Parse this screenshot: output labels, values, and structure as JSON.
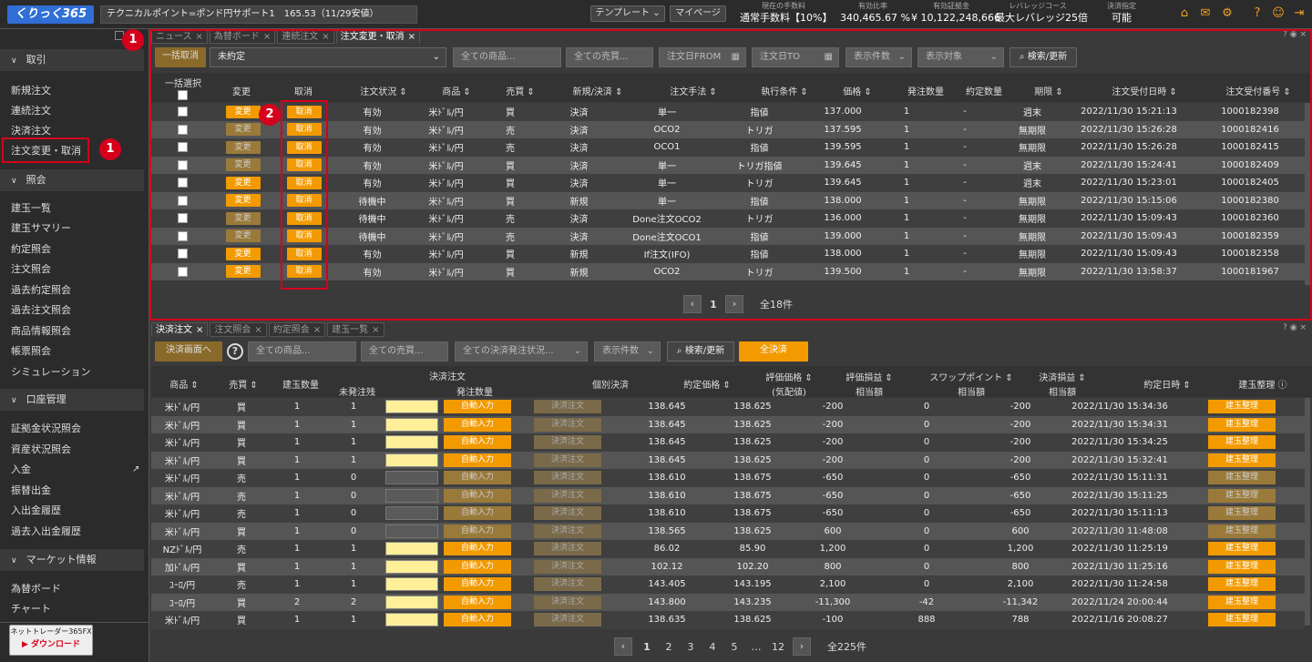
{
  "topbar": {
    "logo": "くりっく365",
    "ticker": "テクニカルポイント=ポンド円サポート1　165.53（11/29安値）",
    "template_btn": "テンプレート ⌄",
    "mypage_btn": "マイページ",
    "stats": [
      {
        "label": "現在の手数料",
        "value": "通常手数料【10%】"
      },
      {
        "label": "有効比率",
        "value": "340,465.67 %"
      },
      {
        "label": "有効証拠金",
        "value": "¥ 10,122,248,666"
      },
      {
        "label": "レバレッジコース",
        "value": "最大レバレッジ25倍"
      },
      {
        "label": "決済指定",
        "value": "可能"
      }
    ]
  },
  "sidebar": {
    "sections": [
      {
        "label": "取引",
        "items": [
          "新規注文",
          "連続注文",
          "決済注文",
          "注文変更・取消"
        ]
      },
      {
        "label": "照会",
        "items": [
          "建玉一覧",
          "建玉サマリー",
          "約定照会",
          "注文照会",
          "過去約定照会",
          "過去注文照会",
          "商品情報照会",
          "帳票照会",
          "シミュレーション"
        ]
      },
      {
        "label": "口座管理",
        "items": [
          "証拠金状況照会",
          "資産状況照会",
          "入金",
          "振替出金",
          "入出金履歴",
          "過去入出金履歴"
        ]
      },
      {
        "label": "マーケット情報",
        "items": [
          "為替ボード",
          "チャート"
        ]
      }
    ],
    "download": {
      "line1": "ネットトレーダー365FX",
      "line2": "ダウンロード"
    }
  },
  "badges": {
    "one": "1",
    "two": "2"
  },
  "upper": {
    "tabs": [
      "ニュース",
      "為替ボード",
      "連続注文",
      "注文変更・取消"
    ],
    "bulk_cancel": "一括取消",
    "status_select": "未約定",
    "filters": [
      "全ての商品...",
      "全ての売買...",
      "注文日FROM",
      "注文日TO",
      "表示件数",
      "表示対象"
    ],
    "search": "検索/更新",
    "headers": [
      "一括選択",
      "変更",
      "取消",
      "注文状況",
      "商品",
      "売買",
      "新規/決済",
      "注文手法",
      "執行条件",
      "価格",
      "発注数量",
      "約定数量",
      "期限",
      "注文受付日時",
      "注文受付番号"
    ],
    "change_label": "変更",
    "cancel_label": "取消",
    "rows": [
      {
        "change_active": true,
        "status": "有効",
        "product": "米ﾄﾞﾙ/円",
        "side": "買",
        "type": "決済",
        "method": "単一",
        "cond": "指値",
        "cond_link": false,
        "price": "137.000",
        "qty": "1",
        "filled": "-",
        "expiry": "週末",
        "date": "2022/11/30 15:21:13",
        "no": "1000182398"
      },
      {
        "change_active": false,
        "status": "有効",
        "product": "米ﾄﾞﾙ/円",
        "side": "売",
        "type": "決済",
        "method": "OCO2",
        "cond": "トリガ",
        "cond_link": false,
        "price": "137.595",
        "qty": "1",
        "filled": "-",
        "expiry": "無期限",
        "date": "2022/11/30 15:26:28",
        "no": "1000182416"
      },
      {
        "change_active": false,
        "status": "有効",
        "product": "米ﾄﾞﾙ/円",
        "side": "売",
        "type": "決済",
        "method": "OCO1",
        "cond": "指値",
        "cond_link": false,
        "price": "139.595",
        "qty": "1",
        "filled": "-",
        "expiry": "無期限",
        "date": "2022/11/30 15:26:28",
        "no": "1000182415"
      },
      {
        "change_active": false,
        "status": "有効",
        "product": "米ﾄﾞﾙ/円",
        "side": "買",
        "type": "決済",
        "method": "単一",
        "cond": "トリガ指値",
        "cond_link": true,
        "price": "139.645",
        "qty": "1",
        "filled": "-",
        "expiry": "週末",
        "date": "2022/11/30 15:24:41",
        "no": "1000182409"
      },
      {
        "change_active": true,
        "status": "有効",
        "product": "米ﾄﾞﾙ/円",
        "side": "買",
        "type": "決済",
        "method": "単一",
        "cond": "トリガ",
        "cond_link": false,
        "price": "139.645",
        "qty": "1",
        "filled": "-",
        "expiry": "週末",
        "date": "2022/11/30 15:23:01",
        "no": "1000182405"
      },
      {
        "change_active": true,
        "status": "待機中",
        "product": "米ﾄﾞﾙ/円",
        "side": "買",
        "type": "新規",
        "method": "単一",
        "cond": "指値",
        "cond_link": false,
        "price": "138.000",
        "qty": "1",
        "filled": "-",
        "expiry": "無期限",
        "date": "2022/11/30 15:15:06",
        "no": "1000182380"
      },
      {
        "change_active": false,
        "status": "待機中",
        "product": "米ﾄﾞﾙ/円",
        "side": "売",
        "type": "決済",
        "method": "Done注文OCO2",
        "cond": "トリガ",
        "cond_link": false,
        "price": "136.000",
        "qty": "1",
        "filled": "-",
        "expiry": "無期限",
        "date": "2022/11/30 15:09:43",
        "no": "1000182360"
      },
      {
        "change_active": false,
        "status": "待機中",
        "product": "米ﾄﾞﾙ/円",
        "side": "売",
        "type": "決済",
        "method": "Done注文OCO1",
        "cond": "指値",
        "cond_link": false,
        "price": "139.000",
        "qty": "1",
        "filled": "-",
        "expiry": "無期限",
        "date": "2022/11/30 15:09:43",
        "no": "1000182359"
      },
      {
        "change_active": true,
        "status": "有効",
        "product": "米ﾄﾞﾙ/円",
        "side": "買",
        "type": "新規",
        "method": "If注文(IFO)",
        "cond": "指値",
        "cond_link": false,
        "price": "138.000",
        "qty": "1",
        "filled": "-",
        "expiry": "無期限",
        "date": "2022/11/30 15:09:43",
        "no": "1000182358"
      },
      {
        "change_active": true,
        "status": "有効",
        "product": "米ﾄﾞﾙ/円",
        "side": "買",
        "type": "新規",
        "method": "OCO2",
        "cond": "トリガ",
        "cond_link": false,
        "price": "139.500",
        "qty": "1",
        "filled": "-",
        "expiry": "無期限",
        "date": "2022/11/30 13:58:37",
        "no": "1000181967"
      }
    ],
    "page": "1",
    "total": "全18件"
  },
  "lower": {
    "tabs": [
      "決済注文",
      "注文照会",
      "約定照会",
      "建玉一覧"
    ],
    "to_order_btn": "決済画面へ",
    "help": "?",
    "filters": [
      "全ての商品...",
      "全ての売買...",
      "全ての決済発注状況...",
      "表示件数"
    ],
    "search": "検索/更新",
    "all_settle": "全決済",
    "headers": {
      "product": "商品",
      "side": "売買",
      "qty": "建玉数量",
      "unfilled": "未発注残",
      "order_top": "決済注文",
      "order_qty": "発注数量",
      "individual": "個別決済",
      "price": "約定価格",
      "eval": "評価価格",
      "eval2": "(気配値)",
      "pl": "評価損益",
      "pl2": "相当額",
      "swap": "スワップポイント",
      "swap2": "相当額",
      "realized": "決済損益",
      "realized2": "相当額",
      "date": "約定日時",
      "arrange": "建玉整理"
    },
    "auto_label": "自動入力",
    "kessai_label": "決済注文",
    "arrange_label": "建玉整理",
    "rows": [
      {
        "product": "米ﾄﾞﾙ/円",
        "side": "買",
        "qty": "1",
        "unfilled": "1",
        "active": true,
        "price": "138.645",
        "eval": "138.625",
        "pl": "-200",
        "swap": "0",
        "realized": "-200",
        "date": "2022/11/30 15:34:36"
      },
      {
        "product": "米ﾄﾞﾙ/円",
        "side": "買",
        "qty": "1",
        "unfilled": "1",
        "active": true,
        "price": "138.645",
        "eval": "138.625",
        "pl": "-200",
        "swap": "0",
        "realized": "-200",
        "date": "2022/11/30 15:34:31"
      },
      {
        "product": "米ﾄﾞﾙ/円",
        "side": "買",
        "qty": "1",
        "unfilled": "1",
        "active": true,
        "price": "138.645",
        "eval": "138.625",
        "pl": "-200",
        "swap": "0",
        "realized": "-200",
        "date": "2022/11/30 15:34:25"
      },
      {
        "product": "米ﾄﾞﾙ/円",
        "side": "買",
        "qty": "1",
        "unfilled": "1",
        "active": true,
        "price": "138.645",
        "eval": "138.625",
        "pl": "-200",
        "swap": "0",
        "realized": "-200",
        "date": "2022/11/30 15:32:41"
      },
      {
        "product": "米ﾄﾞﾙ/円",
        "side": "売",
        "qty": "1",
        "unfilled": "0",
        "active": false,
        "price": "138.610",
        "eval": "138.675",
        "pl": "-650",
        "swap": "0",
        "realized": "-650",
        "date": "2022/11/30 15:11:31"
      },
      {
        "product": "米ﾄﾞﾙ/円",
        "side": "売",
        "qty": "1",
        "unfilled": "0",
        "active": false,
        "price": "138.610",
        "eval": "138.675",
        "pl": "-650",
        "swap": "0",
        "realized": "-650",
        "date": "2022/11/30 15:11:25"
      },
      {
        "product": "米ﾄﾞﾙ/円",
        "side": "売",
        "qty": "1",
        "unfilled": "0",
        "active": false,
        "price": "138.610",
        "eval": "138.675",
        "pl": "-650",
        "swap": "0",
        "realized": "-650",
        "date": "2022/11/30 15:11:13"
      },
      {
        "product": "米ﾄﾞﾙ/円",
        "side": "買",
        "qty": "1",
        "unfilled": "0",
        "active": false,
        "price": "138.565",
        "eval": "138.625",
        "pl": "600",
        "swap": "0",
        "realized": "600",
        "date": "2022/11/30 11:48:08"
      },
      {
        "product": "NZﾄﾞﾙ/円",
        "side": "売",
        "qty": "1",
        "unfilled": "1",
        "active": true,
        "price": "86.02",
        "eval": "85.90",
        "pl": "1,200",
        "swap": "0",
        "realized": "1,200",
        "date": "2022/11/30 11:25:19"
      },
      {
        "product": "加ﾄﾞﾙ/円",
        "side": "買",
        "qty": "1",
        "unfilled": "1",
        "active": true,
        "price": "102.12",
        "eval": "102.20",
        "pl": "800",
        "swap": "0",
        "realized": "800",
        "date": "2022/11/30 11:25:16"
      },
      {
        "product": "ﾕｰﾛ/円",
        "side": "売",
        "qty": "1",
        "unfilled": "1",
        "active": true,
        "price": "143.405",
        "eval": "143.195",
        "pl": "2,100",
        "swap": "0",
        "realized": "2,100",
        "date": "2022/11/30 11:24:58"
      },
      {
        "product": "ﾕｰﾛ/円",
        "side": "買",
        "qty": "2",
        "unfilled": "2",
        "active": true,
        "price": "143.800",
        "eval": "143.235",
        "pl": "-11,300",
        "swap": "-42",
        "realized": "-11,342",
        "date": "2022/11/24 20:00:44"
      },
      {
        "product": "米ﾄﾞﾙ/円",
        "side": "買",
        "qty": "1",
        "unfilled": "1",
        "active": true,
        "price": "138.635",
        "eval": "138.625",
        "pl": "-100",
        "swap": "888",
        "realized": "788",
        "date": "2022/11/16 20:08:27"
      }
    ],
    "pages": [
      "1",
      "2",
      "3",
      "4",
      "5",
      "…",
      "12"
    ],
    "total": "全225件"
  }
}
